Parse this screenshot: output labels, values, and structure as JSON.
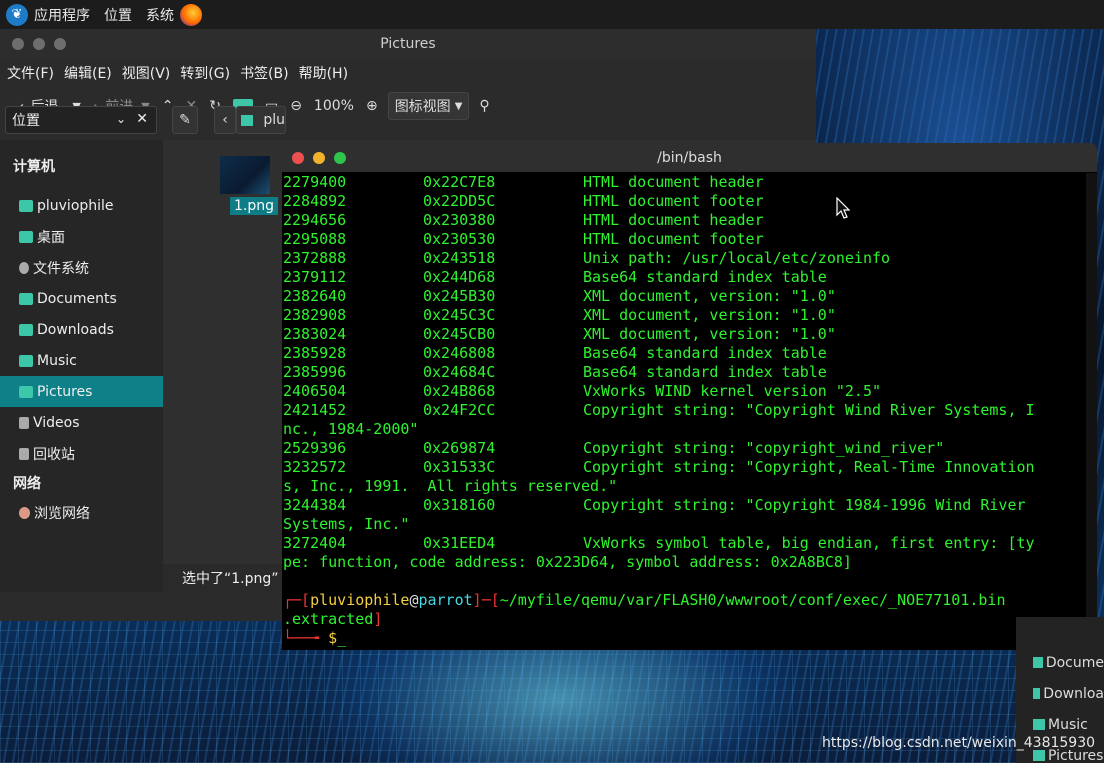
{
  "panel": {
    "menus": [
      "应用程序",
      "位置",
      "系统"
    ]
  },
  "file_manager": {
    "title": "Pictures",
    "menubar": [
      "文件(F)",
      "编辑(E)",
      "视图(V)",
      "转到(G)",
      "书签(B)",
      "帮助(H)"
    ],
    "toolbar": {
      "back": "后退",
      "forward": "前进",
      "zoom": "100%",
      "view_mode": "图标视图"
    },
    "location_select": "位置",
    "path_partial": "plu",
    "sidebar": {
      "computer_header": "计算机",
      "items": [
        "pluviophile",
        "桌面",
        "文件系统",
        "Documents",
        "Downloads",
        "Music",
        "Pictures",
        "Videos",
        "回收站"
      ],
      "network_header": "网络",
      "network_items": [
        "浏览网络"
      ]
    },
    "file": "1.png",
    "status": "选中了“1.png” ("
  },
  "terminal": {
    "title": "/bin/bash",
    "rows": [
      {
        "dec": "2279400",
        "hex": "0x22C7E8",
        "desc": "HTML document header"
      },
      {
        "dec": "2284892",
        "hex": "0x22DD5C",
        "desc": "HTML document footer"
      },
      {
        "dec": "2294656",
        "hex": "0x230380",
        "desc": "HTML document header"
      },
      {
        "dec": "2295088",
        "hex": "0x230530",
        "desc": "HTML document footer"
      },
      {
        "dec": "2372888",
        "hex": "0x243518",
        "desc": "Unix path: /usr/local/etc/zoneinfo"
      },
      {
        "dec": "2379112",
        "hex": "0x244D68",
        "desc": "Base64 standard index table"
      },
      {
        "dec": "2382640",
        "hex": "0x245B30",
        "desc": "XML document, version: \"1.0\""
      },
      {
        "dec": "2382908",
        "hex": "0x245C3C",
        "desc": "XML document, version: \"1.0\""
      },
      {
        "dec": "2383024",
        "hex": "0x245CB0",
        "desc": "XML document, version: \"1.0\""
      },
      {
        "dec": "2385928",
        "hex": "0x246808",
        "desc": "Base64 standard index table"
      },
      {
        "dec": "2385996",
        "hex": "0x24684C",
        "desc": "Base64 standard index table"
      },
      {
        "dec": "2406504",
        "hex": "0x24B868",
        "desc": "VxWorks WIND kernel version \"2.5\""
      },
      {
        "dec": "2421452",
        "hex": "0x24F2CC",
        "desc": "Copyright string: \"Copyright Wind River Systems, I"
      },
      {
        "wrap": "nc., 1984-2000\""
      },
      {
        "dec": "2529396",
        "hex": "0x269874",
        "desc": "Copyright string: \"copyright_wind_river\""
      },
      {
        "dec": "3232572",
        "hex": "0x31533C",
        "desc": "Copyright string: \"Copyright, Real-Time Innovation"
      },
      {
        "wrap": "s, Inc., 1991.  All rights reserved.\""
      },
      {
        "dec": "3244384",
        "hex": "0x318160",
        "desc": "Copyright string: \"Copyright 1984-1996 Wind River"
      },
      {
        "wrap": "Systems, Inc.\""
      },
      {
        "dec": "3272404",
        "hex": "0x31EED4",
        "desc": "VxWorks symbol table, big endian, first entry: [ty"
      },
      {
        "wrap": "pe: function, code address: 0x223D64, symbol address: 0x2A8BC8]"
      }
    ],
    "prompt": {
      "user": "pluviophile",
      "at": "@",
      "host": "parrot",
      "path": "~/myfile/qemu/var/FLASH0/wwwroot/conf/exec/_NOE77101.bin",
      "path_wrap": ".extracted",
      "symbol": "$"
    }
  },
  "background_window": {
    "items": [
      "Docume",
      "Downloa",
      "Music",
      "Pictures"
    ]
  },
  "watermark": "https://blog.csdn.net/weixin_43815930"
}
